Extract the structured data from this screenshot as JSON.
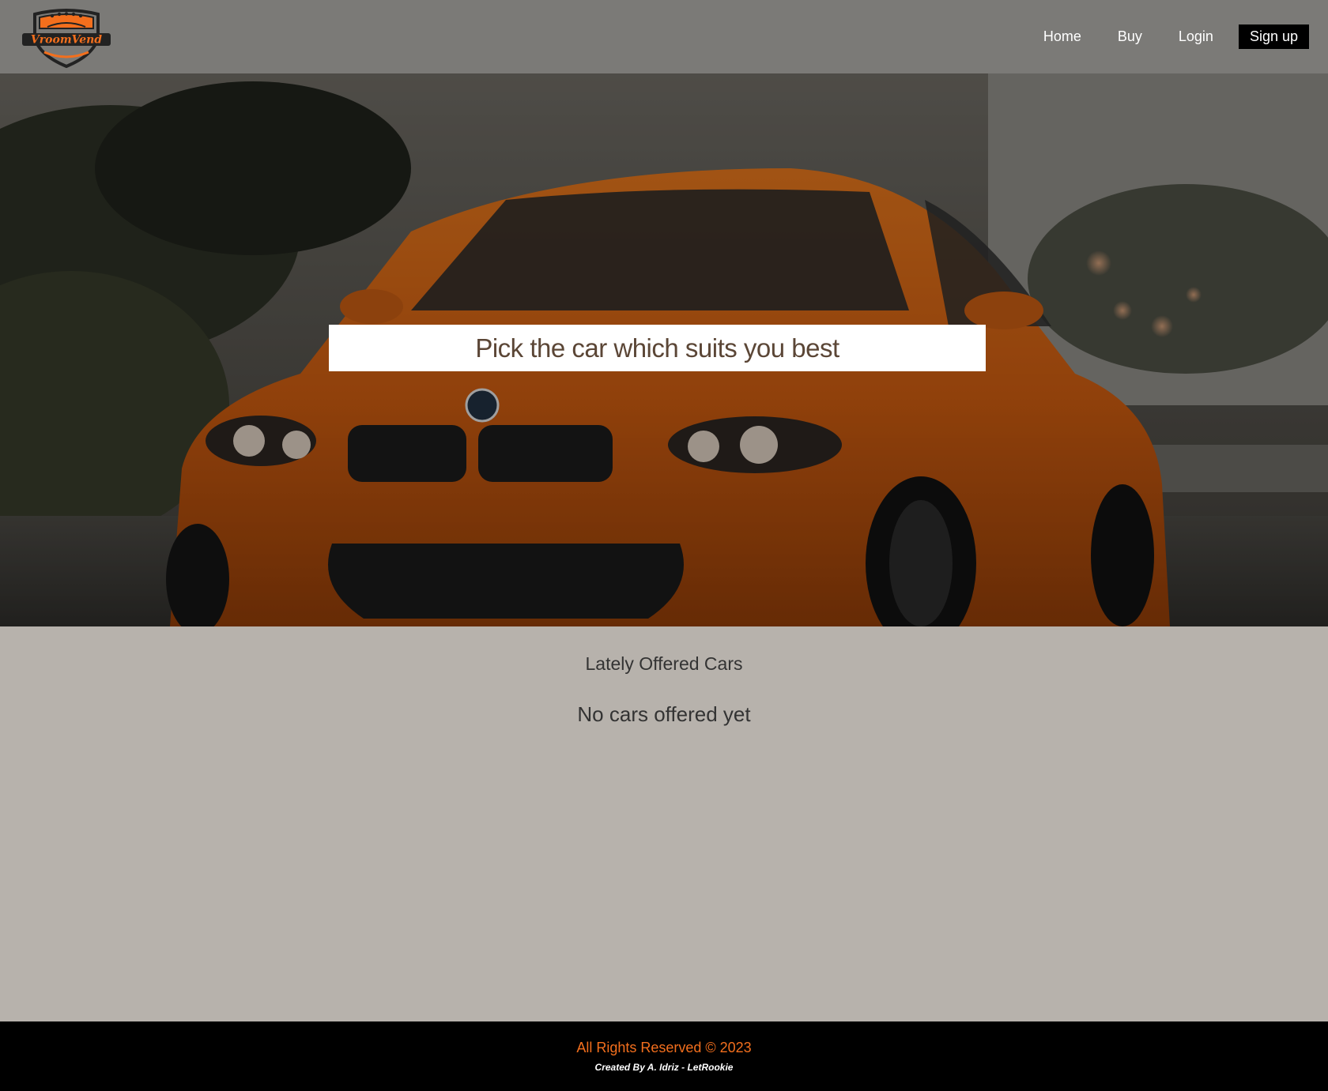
{
  "brand": {
    "logo_text": "VroomVend",
    "accent_color": "#f36f1d"
  },
  "nav": {
    "home": "Home",
    "buy": "Buy",
    "login": "Login",
    "signup": "Sign up"
  },
  "hero": {
    "tagline": "Pick the car which suits you best",
    "image": "orange-sports-car"
  },
  "offers": {
    "title": "Lately Offered Cars",
    "empty_message": "No cars offered yet"
  },
  "footer": {
    "copyright": "All Rights Reserved © 2023",
    "credit": "Created By A. Idriz - LetRookie"
  },
  "colors": {
    "header_bg": "#7b7a77",
    "page_bg": "#b7b2ac",
    "footer_bg": "#000000",
    "signup_bg": "#000000",
    "banner_text": "#5b4636"
  }
}
